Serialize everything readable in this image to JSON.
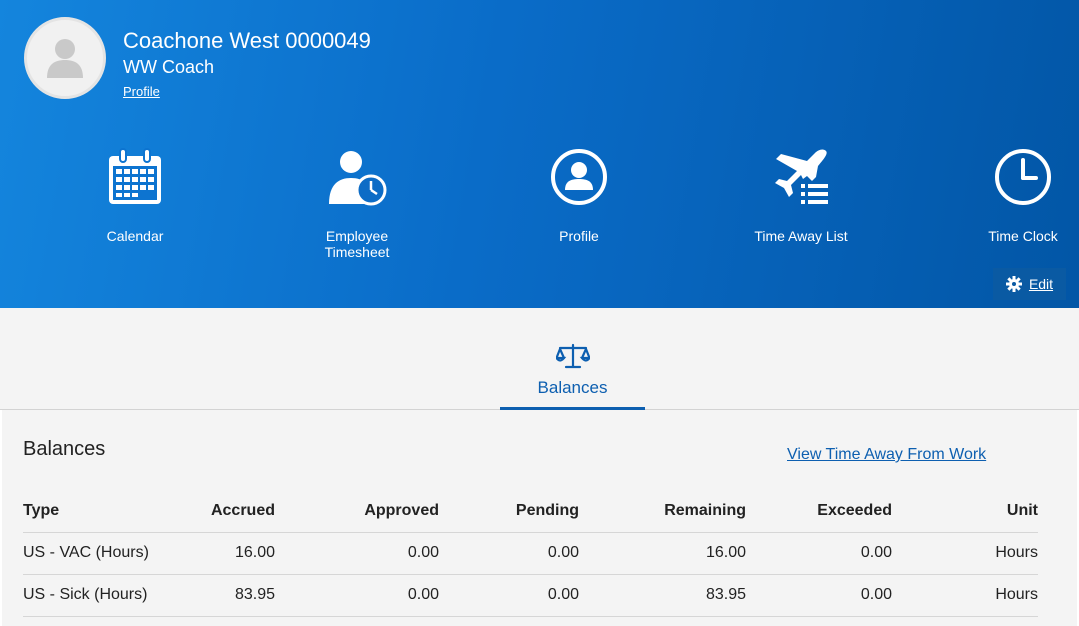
{
  "user": {
    "name": "Coachone West 0000049",
    "role": "WW Coach",
    "profile_link": "Profile"
  },
  "tiles": [
    {
      "label": "Calendar",
      "icon": "calendar-icon"
    },
    {
      "label": "Employee\nTimesheet",
      "icon": "employee-timesheet-icon"
    },
    {
      "label": "Profile",
      "icon": "profile-icon"
    },
    {
      "label": "Time Away List",
      "icon": "airplane-list-icon"
    },
    {
      "label": "Time Clock",
      "icon": "clock-icon"
    }
  ],
  "edit": {
    "label": "Edit",
    "icon": "gear-icon"
  },
  "tabs": [
    {
      "label": "Balances",
      "icon": "scales-icon"
    }
  ],
  "balances": {
    "title": "Balances",
    "view_link": "View Time Away From Work",
    "columns": [
      "Type",
      "Accrued",
      "Approved",
      "Pending",
      "Remaining",
      "Exceeded",
      "Unit"
    ],
    "rows": [
      [
        "US - VAC (Hours)",
        "16.00",
        "0.00",
        "0.00",
        "16.00",
        "0.00",
        "Hours"
      ],
      [
        "US - Sick (Hours)",
        "83.95",
        "0.00",
        "0.00",
        "83.95",
        "0.00",
        "Hours"
      ]
    ]
  },
  "colors": {
    "header_start": "#1485dd",
    "header_end": "#0256a6",
    "accent": "#0d5fb0"
  }
}
